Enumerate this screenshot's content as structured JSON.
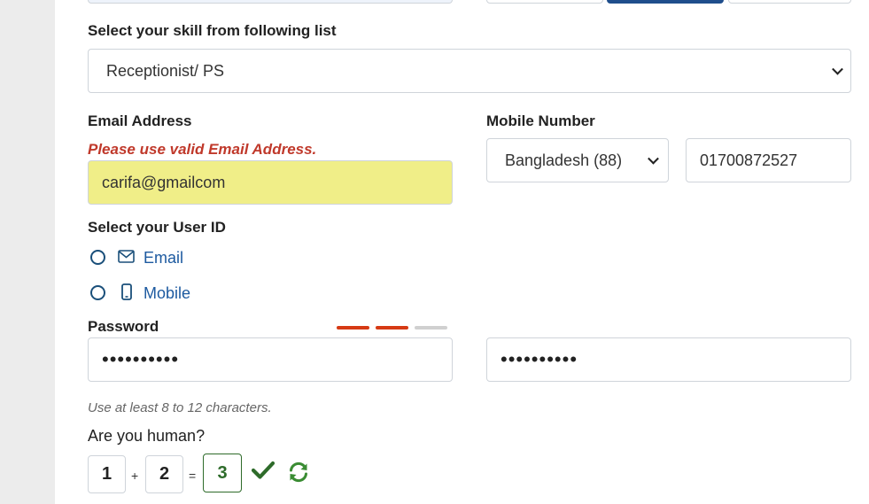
{
  "colors": {
    "label": "#222222",
    "error": "#c0392b",
    "invalid_field_bg": "#f0ee88",
    "link": "#1d5aa0",
    "strength_active": "#d63a14",
    "strength_inactive": "#d0d0d0",
    "captcha_ok": "#2e6b2a"
  },
  "skill": {
    "label": "Select your skill from following list",
    "selected": "Receptionist/ PS"
  },
  "email": {
    "label": "Email Address",
    "error": "Please use valid Email Address.",
    "value": "carifa@gmailcom"
  },
  "mobile": {
    "label": "Mobile Number",
    "country_selected": "Bangladesh (88)",
    "number": "01700872527"
  },
  "user_id": {
    "label": "Select your User ID",
    "options": [
      {
        "label": "Email",
        "icon": "envelope-icon",
        "selected": false
      },
      {
        "label": "Mobile",
        "icon": "mobile-phone-icon",
        "selected": false
      }
    ]
  },
  "password": {
    "label": "Password",
    "value_masked": "••••••••••",
    "confirm_masked": "••••••••••",
    "strength": {
      "active": 2,
      "total": 3
    },
    "hint": "Use at least 8 to 12 characters."
  },
  "captcha": {
    "label": "Are you human?",
    "a": "1",
    "plus": "+",
    "b": "2",
    "equals": "=",
    "answer": "3",
    "status_icon": "check-icon",
    "refresh_icon": "refresh-icon"
  }
}
